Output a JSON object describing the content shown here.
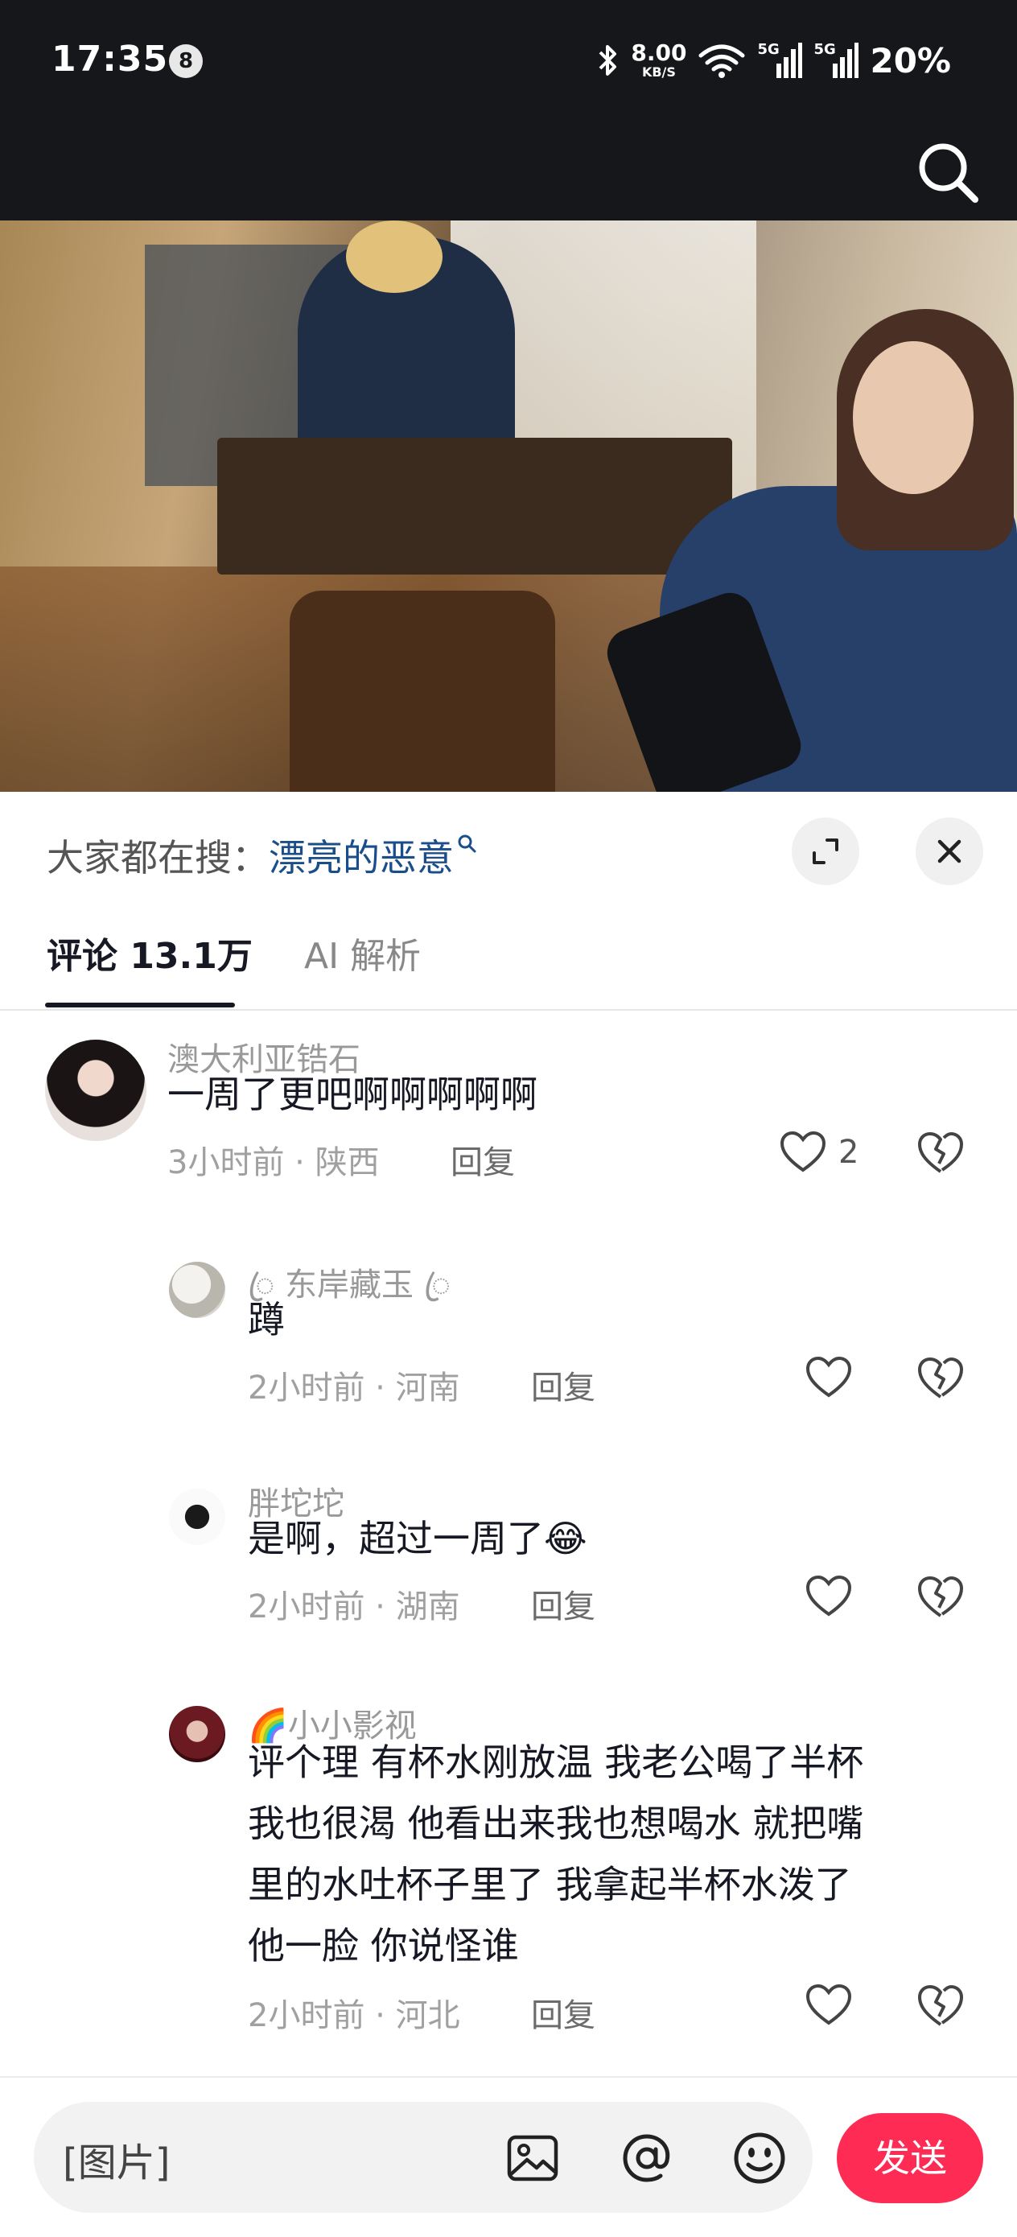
{
  "status_bar": {
    "time": "17:35",
    "notification_count": "8",
    "net_speed_value": "8.00",
    "net_speed_unit": "KB/S",
    "signal1_tag": "5G",
    "signal2_tag": "5G",
    "battery": "20%"
  },
  "header": {
    "search_icon": "search-icon"
  },
  "sheet": {
    "hot_search_label": "大家都在搜：",
    "hot_search_keyword": "漂亮的恶意",
    "tabs": [
      {
        "label": "评论 13.1万",
        "active": true
      },
      {
        "label": "AI 解析",
        "active": false
      }
    ]
  },
  "comments": [
    {
      "user": "澳大利亚锆石",
      "text": "一周了更吧啊啊啊啊啊",
      "meta": "3小时前 · 陕西",
      "reply": "回复",
      "likes": "2"
    },
    {
      "user": "ꦿ 东岸藏玉 ꦿ",
      "text": "蹲",
      "meta": "2小时前 · 河南",
      "reply": "回复",
      "likes": ""
    },
    {
      "user": "胖坨坨",
      "text": "是啊，超过一周了",
      "emoji": "😂",
      "meta": "2小时前 · 湖南",
      "reply": "回复",
      "likes": ""
    },
    {
      "user_prefix": "🌈",
      "user": "小小影视",
      "text_lines": [
        "评个理  有杯水刚放温  我老公喝了半杯",
        "我也很渴  他看出来我也想喝水  就把嘴",
        "里的水吐杯子里了  我拿起半杯水泼了",
        "他一脸  你说怪谁"
      ],
      "meta": "2小时前 · 河北",
      "reply": "回复",
      "likes": ""
    }
  ],
  "input_bar": {
    "placeholder": "[图片]",
    "send_label": "发送"
  },
  "colors": {
    "accent": "#fe2c55",
    "keyword": "#1a4e8a",
    "status_bar_bg": "#15171a"
  }
}
